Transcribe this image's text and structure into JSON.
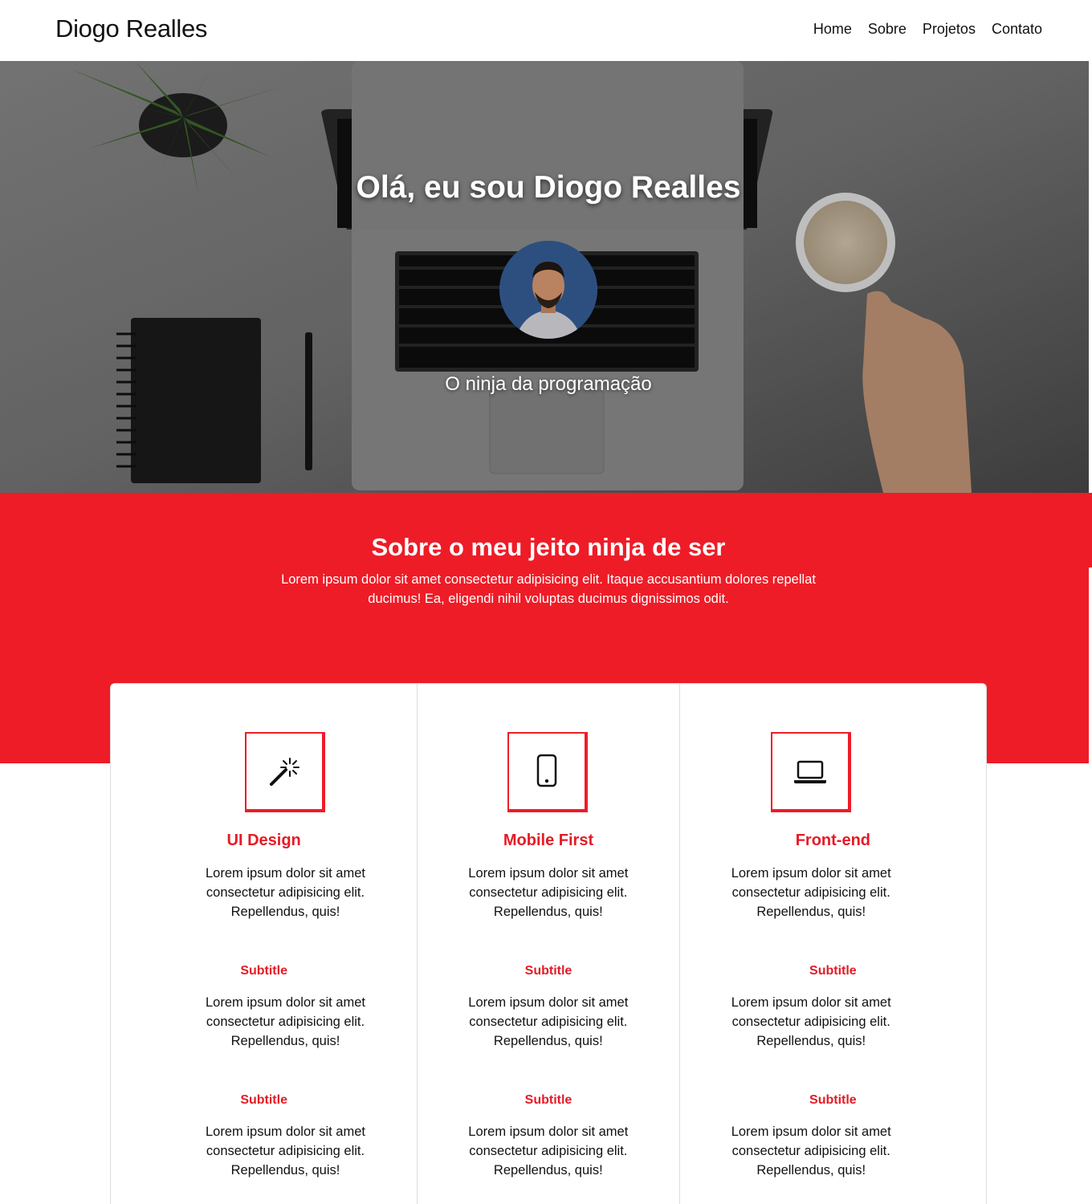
{
  "header": {
    "brand": "Diogo Realles",
    "nav": [
      "Home",
      "Sobre",
      "Projetos",
      "Contato"
    ]
  },
  "hero": {
    "title": "Olá, eu sou Diogo Realles",
    "subtitle": "O ninja da programação",
    "avatar_alt": "profile-photo"
  },
  "about": {
    "title": "Sobre o meu jeito ninja de ser",
    "text": "Lorem ipsum dolor sit amet consectetur adipisicing elit. Itaque accusantium dolores repellat ducimus! Ea, eligendi nihil voluptas ducimus dignissimos odit."
  },
  "features": [
    {
      "icon": "magic-wand-icon",
      "title": "UI Design",
      "text": "Lorem ipsum dolor sit amet consectetur adipisicing elit. Repellendus, quis!",
      "items": [
        {
          "subtitle": "Subtitle",
          "text": "Lorem ipsum dolor sit amet consectetur adipisicing elit. Repellendus, quis!"
        },
        {
          "subtitle": "Subtitle",
          "text": "Lorem ipsum dolor sit amet consectetur adipisicing elit. Repellendus, quis!"
        }
      ]
    },
    {
      "icon": "mobile-phone-icon",
      "title": "Mobile First",
      "text": "Lorem ipsum dolor sit amet consectetur adipisicing elit. Repellendus, quis!",
      "items": [
        {
          "subtitle": "Subtitle",
          "text": "Lorem ipsum dolor sit amet consectetur adipisicing elit. Repellendus, quis!"
        },
        {
          "subtitle": "Subtitle",
          "text": "Lorem ipsum dolor sit amet consectetur adipisicing elit. Repellendus, quis!"
        }
      ]
    },
    {
      "icon": "laptop-icon",
      "title": "Front-end",
      "text": "Lorem ipsum dolor sit amet consectetur adipisicing elit. Repellendus, quis!",
      "items": [
        {
          "subtitle": "Subtitle",
          "text": "Lorem ipsum dolor sit amet consectetur adipisicing elit. Repellendus, quis!"
        },
        {
          "subtitle": "Subtitle",
          "text": "Lorem ipsum dolor sit amet consectetur adipisicing elit. Repellendus, quis!"
        }
      ]
    }
  ],
  "colors": {
    "accent": "#ee1c27",
    "text": "#111111"
  }
}
